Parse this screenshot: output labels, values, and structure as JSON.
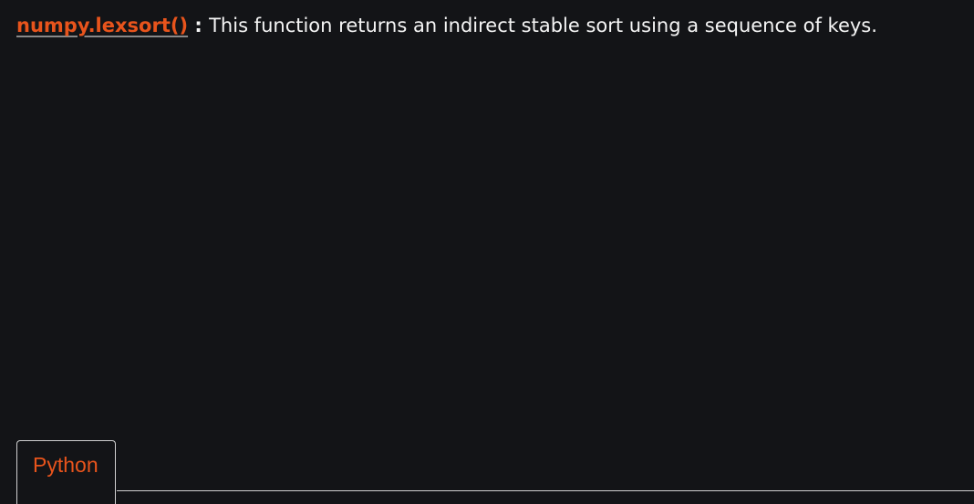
{
  "heading": {
    "link": "numpy.lexsort()",
    "separator": " : ",
    "description": "This function returns an indirect stable sort using a sequence of keys."
  },
  "tabs": [
    {
      "label": "Python",
      "active": true
    }
  ],
  "colors": {
    "accent": "#e8541c",
    "background": "#131417"
  }
}
